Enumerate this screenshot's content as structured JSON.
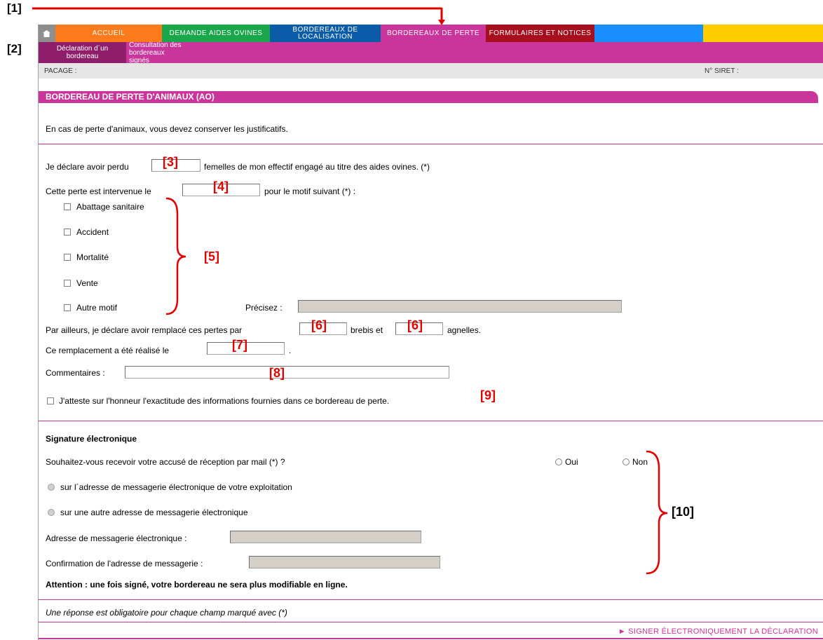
{
  "annotations": {
    "a1": "[1]",
    "a2": "[2]",
    "a3": "[3]",
    "a4": "[4]",
    "a5": "[5]",
    "a6a": "[6]",
    "a6b": "[6]",
    "a7": "[7]",
    "a8": "[8]",
    "a9": "[9]",
    "a10": "[10]"
  },
  "nav": {
    "tabs": [
      {
        "label": "ACCUEIL",
        "color": "#ff7a1a"
      },
      {
        "label": "DEMANDE AIDES OVINES",
        "color": "#1aa64a"
      },
      {
        "label": "BORDEREAUX DE LOCALISATION",
        "color": "#0b5ca8"
      },
      {
        "label": "BORDEREAUX DE PERTE",
        "color": "#c9359a"
      },
      {
        "label": "FORMULAIRES ET NOTICES",
        "color": "#a80f1c"
      },
      {
        "label": "",
        "color": "#1a8fff"
      },
      {
        "label": "",
        "color": "#ffcc00"
      }
    ],
    "home_icon": "home-icon"
  },
  "subnav": {
    "items": [
      {
        "label": "Déclaration d´un bordereau"
      },
      {
        "label": "Consultation des bordereaux signés"
      }
    ]
  },
  "ident": {
    "pacage": "PACAGE :",
    "siret": "N° SIRET :"
  },
  "section_title": "BORDEREAU DE PERTE D'ANIMAUX (AO)",
  "intro": "En cas de perte d'animaux, vous devez conserver les justificatifs.",
  "loss": {
    "prefix": "Je déclare avoir perdu",
    "suffix": "femelles de mon effectif engagé au titre des aides ovines. (*)",
    "date_prefix": "Cette perte est intervenue le",
    "date_suffix": "pour le motif suivant (*) :",
    "reasons": [
      "Abattage sanitaire",
      "Accident",
      "Mortalité",
      "Vente",
      "Autre motif"
    ],
    "specify_label": "Précisez :"
  },
  "replacement": {
    "prefix": "Par ailleurs, je déclare avoir remplacé ces pertes par",
    "middle": "brebis et",
    "suffix": "agnelles.",
    "date_prefix": "Ce remplacement a été réalisé le",
    "date_suffix": "."
  },
  "comments_label": "Commentaires :",
  "attest": "J'atteste sur l'honneur l'exactitude des informations fournies dans ce bordereau de perte.",
  "signature": {
    "title": "Signature électronique",
    "question": "Souhaitez-vous recevoir votre accusé de réception par mail (*) ?",
    "yes": "Oui",
    "no": "Non",
    "opt1": "sur l´adresse de messagerie électronique de votre exploitation",
    "opt2": "sur une autre adresse de messagerie électronique",
    "email_label": "Adresse de messagerie électronique :",
    "confirm_label": "Confirmation de l'adresse de messagerie :",
    "warning": "Attention : une fois signé, votre bordereau ne sera plus modifiable en ligne."
  },
  "footer_note": "Une réponse est obligatoire pour chaque champ marqué avec (*)",
  "sign_button": "SIGNER ÉLECTRONIQUEMENT LA DÉCLARATION"
}
